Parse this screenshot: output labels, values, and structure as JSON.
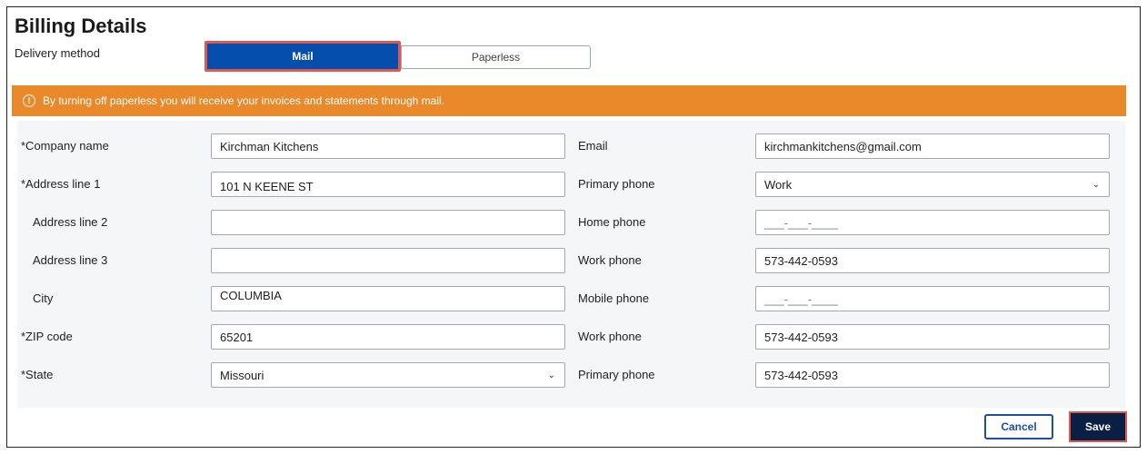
{
  "page": {
    "title": "Billing Details",
    "delivery_label": "Delivery method",
    "delivery_options": [
      "Mail",
      "Paperless"
    ],
    "delivery_selected": "Mail"
  },
  "banner": {
    "icon": "info-icon",
    "text": "By turning off paperless you will receive your invoices and statements through mail.",
    "color": "#e9892a"
  },
  "left_fields": [
    {
      "label": "*Company name",
      "value": "Kirchman Kitchens"
    },
    {
      "label": "*Address line 1",
      "value": "101 N KEENE ST"
    },
    {
      "label": "Address line 2",
      "value": ""
    },
    {
      "label": "Address line 3",
      "value": ""
    },
    {
      "label": "City",
      "value": "COLUMBIA"
    },
    {
      "label": "*ZIP code",
      "value": "65201"
    },
    {
      "label": "*State",
      "value": "Missouri"
    }
  ],
  "right_fields": [
    {
      "label": "Email",
      "value": "kirchmankitchens@gmail.com"
    },
    {
      "label": "Primary phone",
      "value": "Work"
    },
    {
      "label": "Home phone",
      "value": "___-___-____"
    },
    {
      "label": "Work phone",
      "value": "573-442-0593"
    },
    {
      "label": "Mobile phone",
      "value": "___-___-____"
    },
    {
      "label": "Work phone",
      "value": "573-442-0593"
    },
    {
      "label": "Primary phone",
      "value": "573-442-0593"
    }
  ],
  "actions": {
    "cancel": "Cancel",
    "save": "Save"
  },
  "colors": {
    "primary": "#064eab",
    "highlight": "#e0574f",
    "save_bg": "#0b1f45"
  }
}
